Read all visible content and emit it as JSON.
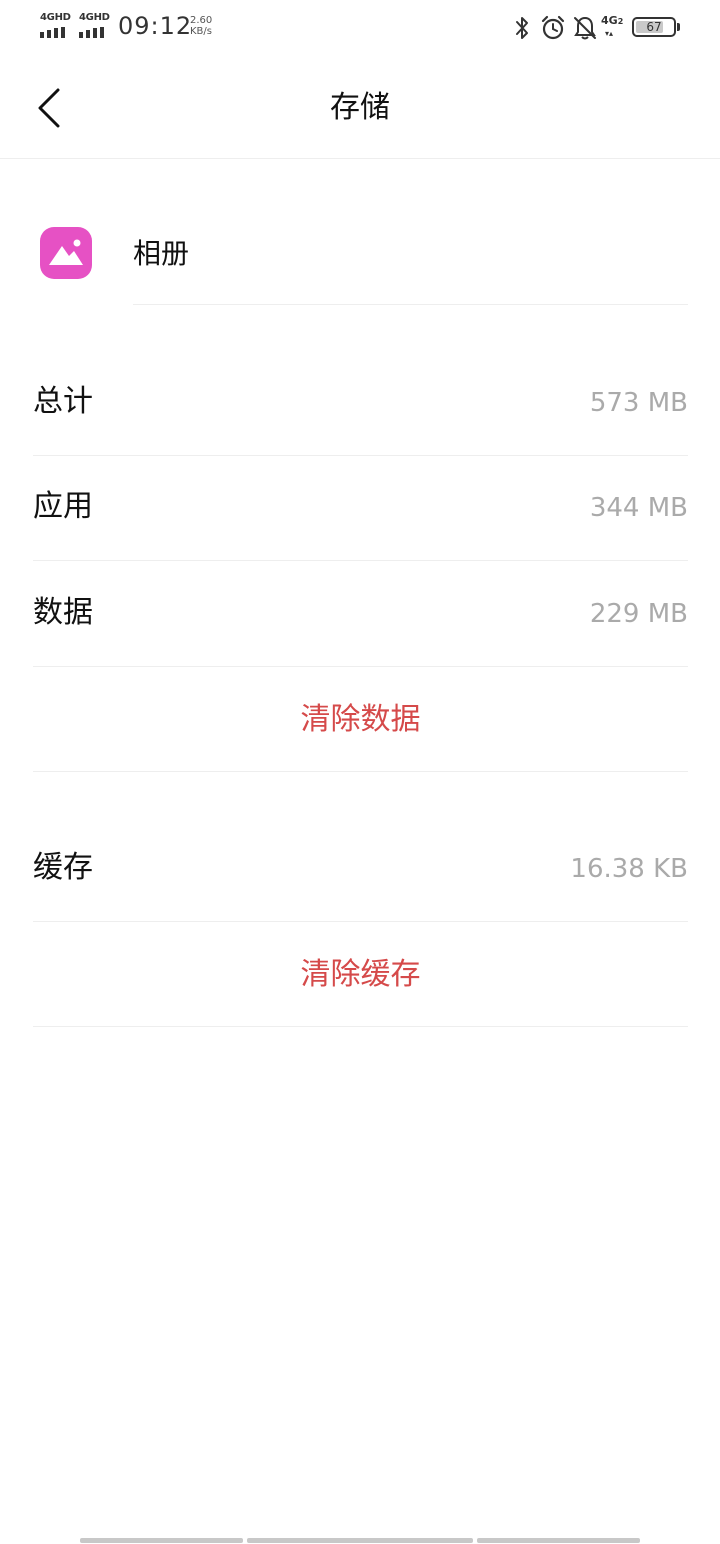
{
  "status_bar": {
    "signal1_label": "4GHD",
    "signal2_label": "4GHD",
    "time": "09:12",
    "speed_value": "2.60",
    "speed_unit": "KB/s",
    "network_label": "4G",
    "network_sub": "2",
    "battery_level": "67",
    "icons": [
      "bluetooth-icon",
      "alarm-icon",
      "bell-off-icon",
      "network-4g-icon",
      "battery-icon"
    ]
  },
  "header": {
    "back_icon": "chevron-left-icon",
    "title": "存储"
  },
  "app": {
    "icon": "gallery-icon",
    "icon_color": "#e651c4",
    "name": "相册"
  },
  "storage": {
    "total": {
      "label": "总计",
      "value": "573 MB"
    },
    "app": {
      "label": "应用",
      "value": "344 MB"
    },
    "data": {
      "label": "数据",
      "value": "229 MB"
    },
    "clear_data_label": "清除数据",
    "cache": {
      "label": "缓存",
      "value": "16.38 KB"
    },
    "clear_cache_label": "清除缓存"
  },
  "colors": {
    "action_red": "#d54a4a",
    "value_gray": "#aaaaaa",
    "divider": "#eeeeee"
  }
}
